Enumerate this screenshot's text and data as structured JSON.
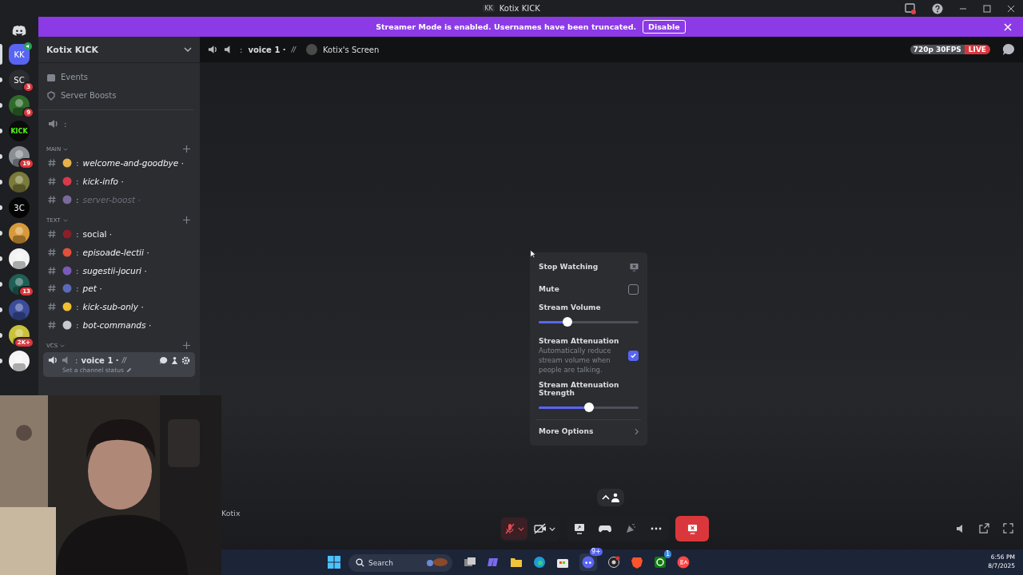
{
  "window": {
    "title": "Kotix KICK",
    "icon_text": "KK"
  },
  "servers": [
    {
      "kind": "text",
      "label": "KK",
      "color": "#5865f2",
      "selected": true
    },
    {
      "kind": "text",
      "label": "SC",
      "color": "#2b2d31",
      "badge": "3",
      "selected": false
    },
    {
      "kind": "picture",
      "color": "#2f6b2a",
      "badge": "9",
      "selected": false
    },
    {
      "kind": "text",
      "label": "KICK",
      "color": "#0b0b0b",
      "selected": false
    },
    {
      "kind": "picture",
      "color": "#8a8f94",
      "badge": "19",
      "selected": false
    },
    {
      "kind": "picture",
      "color": "#7a7a3a",
      "selected": false
    },
    {
      "kind": "text",
      "label": "3C",
      "color": "#050505",
      "selected": false
    },
    {
      "kind": "picture",
      "color": "#d79a3a",
      "selected": false
    },
    {
      "kind": "picture",
      "color": "#f2f2f2",
      "selected": false
    },
    {
      "kind": "picture",
      "color": "#1f5f55",
      "badge": "13",
      "selected": false
    },
    {
      "kind": "picture",
      "color": "#3a4c9a",
      "selected": false
    },
    {
      "kind": "picture",
      "color": "#c9c23a",
      "badge": "2K+",
      "selected": false
    },
    {
      "kind": "picture",
      "color": "#f4f4f4",
      "selected": false
    }
  ],
  "banner": {
    "text": "Streamer Mode is enabled. Usernames have been truncated.",
    "button": "Disable"
  },
  "server_name": "Kotix KICK",
  "sidebar_links": [
    "Events",
    "Server Boosts"
  ],
  "voice_stage": ":",
  "categories": [
    {
      "name": "MAIN",
      "channels": [
        {
          "color": "#e8b04a",
          "prefix": ":",
          "name": "welcome-and-goodbye ·",
          "italic": true,
          "muted": false
        },
        {
          "color": "#d93a4a",
          "prefix": ":",
          "name": "kick-info ·",
          "italic": true,
          "muted": false
        },
        {
          "color": "#7a6a9a",
          "prefix": ":",
          "name": "server-boost ·",
          "italic": true,
          "muted": true
        }
      ]
    },
    {
      "name": "TEXT",
      "channels": [
        {
          "color": "#8a1f2a",
          "prefix": ":",
          "name": "social ·",
          "italic": false,
          "muted": false
        },
        {
          "color": "#e0503a",
          "prefix": ":",
          "name": "episoade-lectii ·",
          "italic": true,
          "muted": false
        },
        {
          "color": "#7a5ab8",
          "prefix": ":",
          "name": "sugestii-jocuri ·",
          "italic": true,
          "muted": false
        },
        {
          "color": "#5a6ab8",
          "prefix": ":",
          "name": "pet ·",
          "italic": true,
          "muted": false
        },
        {
          "color": "#f0c030",
          "prefix": ":",
          "name": "kick-sub-only ·",
          "italic": true,
          "muted": false
        },
        {
          "color": "#c8c8d0",
          "prefix": ":",
          "name": "bot-commands ·",
          "italic": true,
          "muted": false
        }
      ]
    }
  ],
  "voice_category": "VCS",
  "voice_channel": {
    "prefix": ":",
    "name": "voice 1 ·",
    "suffix": "//",
    "status": "Set a channel status"
  },
  "header": {
    "prefix": ":",
    "channel": "voice 1 ·",
    "suffix": "//",
    "stream": "Kotix's Screen",
    "quality": "720p 30FPS",
    "live": "LIVE"
  },
  "popup": [
    {
      "kind": "action",
      "label": "Stop Watching"
    },
    {
      "kind": "checkbox",
      "label": "Mute",
      "checked": false
    },
    {
      "kind": "slider",
      "label": "Stream Volume",
      "level": 0.29
    },
    {
      "kind": "checkbox",
      "label": "Stream Attenuation",
      "description": "Automatically reduce stream volume when people are talking.",
      "checked": true
    },
    {
      "kind": "slider",
      "label": "Stream Attenuation Strength",
      "level": 0.5
    },
    {
      "kind": "submenu",
      "label": "More Options"
    }
  ],
  "streamer_label": "Kotix",
  "controls": {
    "mic_muted": true,
    "camera_off": true
  },
  "taskbar": {
    "placeholder": "Search",
    "time": "6:56 PM",
    "date": "8/7/2025",
    "discord_badge": "9+",
    "xbox_badge": "1"
  }
}
